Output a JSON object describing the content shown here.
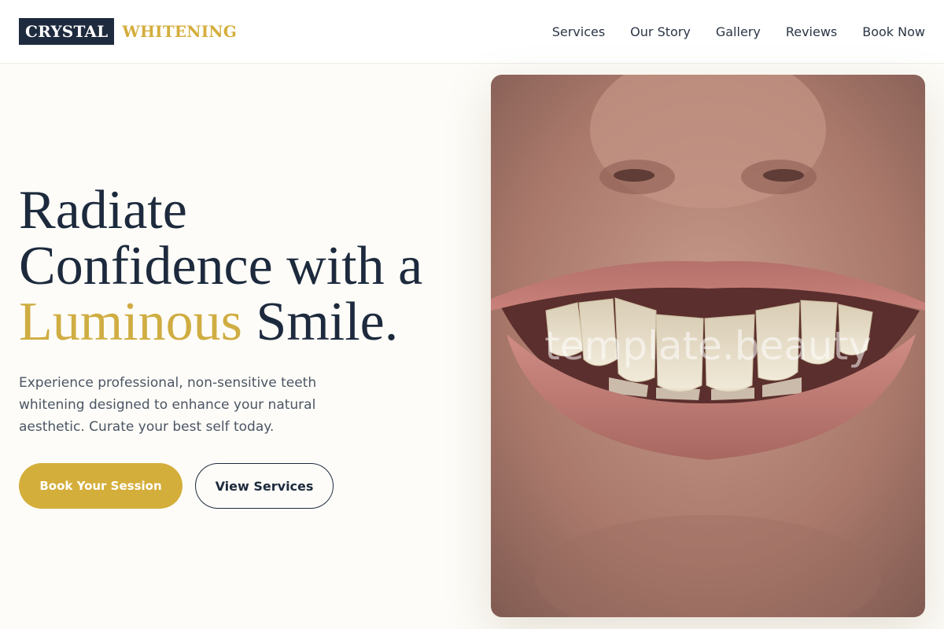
{
  "brand": {
    "name_primary": "CRYSTAL",
    "name_secondary": "WHITENING",
    "colors": {
      "navy": "#1e2a3e",
      "gold": "#d4ad3c",
      "background": "#fdfcf8"
    }
  },
  "nav": {
    "items": [
      {
        "label": "Services"
      },
      {
        "label": "Our Story"
      },
      {
        "label": "Gallery"
      },
      {
        "label": "Reviews"
      },
      {
        "label": "Book Now"
      }
    ]
  },
  "hero": {
    "title_line1": "Radiate",
    "title_line2": "Confidence with a",
    "title_highlight": "Luminous",
    "title_end": " Smile.",
    "subtitle": "Experience professional, non-sensitive teeth whitening designed to enhance your natural aesthetic. Curate your best self today.",
    "primary_cta": "Book Your Session",
    "secondary_cta": "View Services",
    "image": {
      "icon": "smile-photo",
      "watermark": "template.beauty"
    }
  }
}
